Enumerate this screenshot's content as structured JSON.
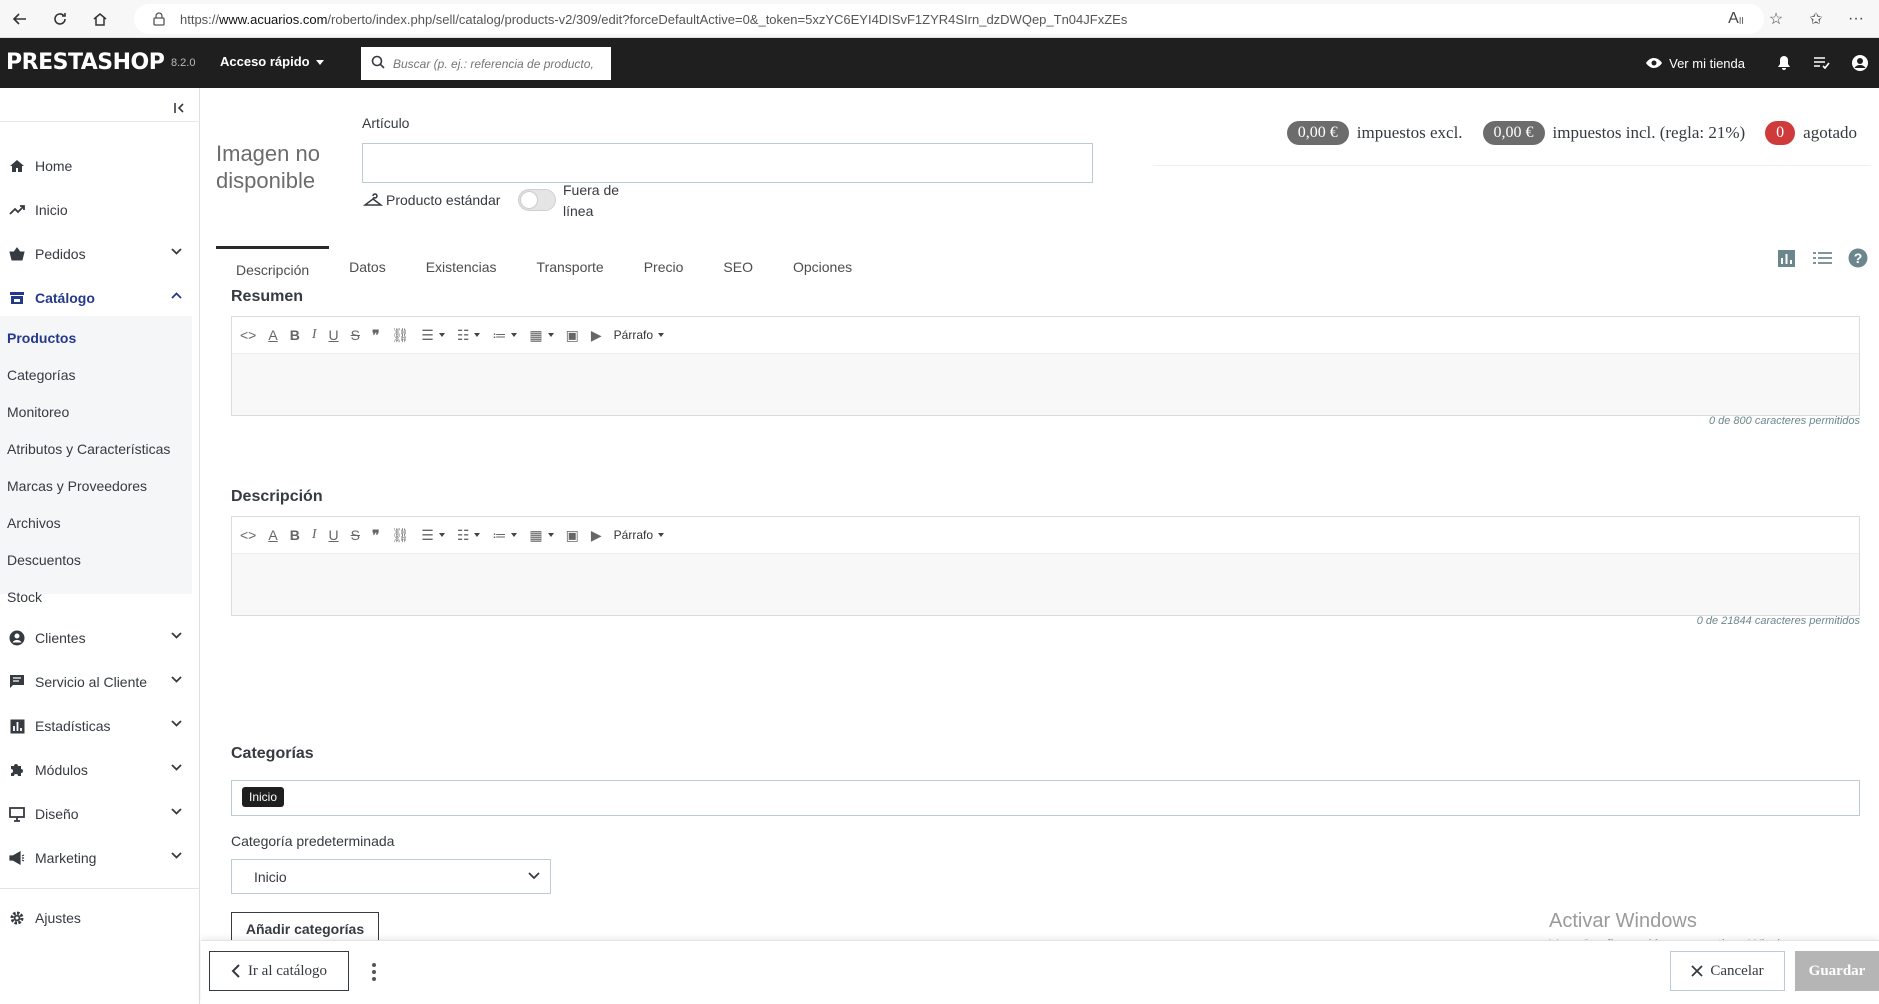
{
  "browser": {
    "url_prefix": "https://",
    "url_host": "www.acuarios.com",
    "url_path": "/roberto/index.php/sell/catalog/products-v2/309/edit?forceDefaultActive=0&_token=5xzYC6EYI4DISvF1ZYR4SIrn_dzDWQep_Tn04JFxZEs"
  },
  "header": {
    "logo": "PRESTASHOP",
    "version": "8.2.0",
    "quick_access": "Acceso rápido",
    "search_placeholder": "Buscar (p. ej.: referencia de producto,",
    "view_shop": "Ver mi tienda"
  },
  "sidebar": {
    "items": [
      {
        "label": "Home",
        "icon": "home-icon"
      },
      {
        "label": "Inicio",
        "icon": "trending-icon"
      },
      {
        "label": "Pedidos",
        "icon": "basket-icon"
      },
      {
        "label": "Catálogo",
        "icon": "store-icon"
      },
      {
        "label": "Clientes",
        "icon": "account-icon"
      },
      {
        "label": "Servicio al Cliente",
        "icon": "chat-icon"
      },
      {
        "label": "Estadísticas",
        "icon": "chart-icon"
      },
      {
        "label": "Módulos",
        "icon": "puzzle-icon"
      },
      {
        "label": "Diseño",
        "icon": "desktop-icon"
      },
      {
        "label": "Marketing",
        "icon": "megaphone-icon"
      },
      {
        "label": "Ajustes",
        "icon": "gear-icon"
      }
    ],
    "catalog_sub": [
      "Productos",
      "Categorías",
      "Monitoreo",
      "Atributos y Características",
      "Marcas y Proveedores",
      "Archivos",
      "Descuentos",
      "Stock"
    ]
  },
  "product": {
    "image_placeholder": "Imagen no disponible",
    "name_label": "Artículo",
    "name_value": "",
    "type": "Producto estándar",
    "offline_label": "Fuera de línea",
    "offline_on": false,
    "price_excl": "0,00 €",
    "price_excl_label": "impuestos excl.",
    "price_incl": "0,00 €",
    "price_incl_label": "impuestos incl. (regla: 21%)",
    "stock_count": "0",
    "stock_label": "agotado"
  },
  "tabs": [
    "Descripción",
    "Datos",
    "Existencias",
    "Transporte",
    "Precio",
    "SEO",
    "Opciones"
  ],
  "summary": {
    "title": "Resumen",
    "counter": "0 de 800 caracteres permitidos"
  },
  "description": {
    "title": "Descripción",
    "counter": "0 de 21844 caracteres permitidos"
  },
  "editor": {
    "paragraph": "Párrafo"
  },
  "categories": {
    "title": "Categorías",
    "tag": "Inicio",
    "default_label": "Categoría predeterminada",
    "default_value": "Inicio",
    "add_button": "Añadir categorías"
  },
  "watermark": {
    "line1": "Activar Windows",
    "line2": "Ve a Configuración para activar Windows."
  },
  "footer": {
    "catalog_button": "Ir al catálogo",
    "cancel_button": "Cancelar",
    "save_button": "Guardar"
  },
  "colors": {
    "header_bg": "#1f1f1f",
    "accent": "#25398c",
    "stock_badge": "#cf3b3b",
    "price_badge": "#6c6c6c"
  }
}
